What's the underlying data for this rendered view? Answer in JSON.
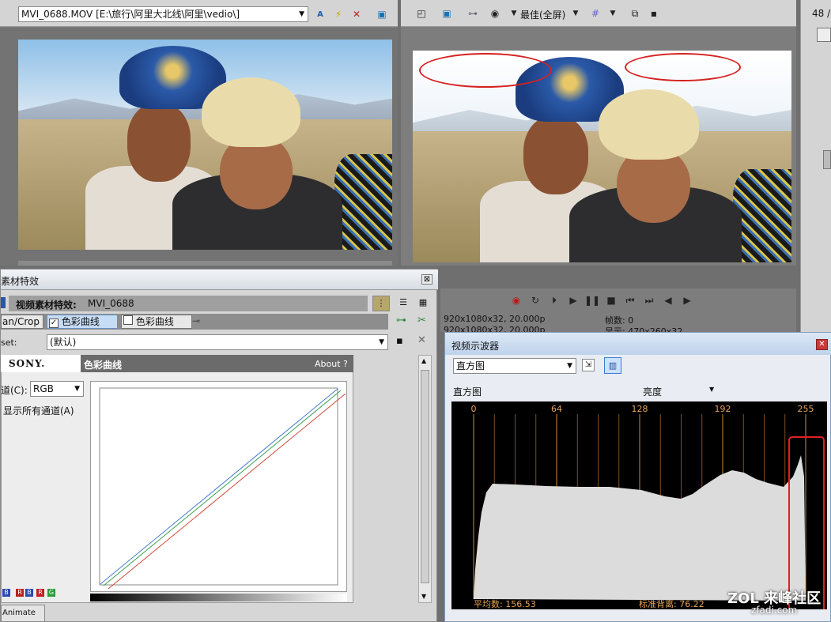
{
  "trimmer": {
    "file_select": "MVI_0688.MOV     [E:\\旅行\\阿里大北线\\阿里\\vedio\\]"
  },
  "preview": {
    "quality": "最佳(全屏)",
    "info_left": [
      "920x1080x32, 20.000p",
      "920x1080x32, 20.000p"
    ],
    "info_right": [
      "帧数: 0",
      "显示: 470x260x32"
    ]
  },
  "right_panel": {
    "label": "48 /"
  },
  "fx": {
    "window_title": "素材特效",
    "header_label": "视频素材特效:",
    "header_clip": "MVI_0688",
    "chain": [
      "an/Crop",
      "色彩曲线",
      "色彩曲线"
    ],
    "preset_label": "set:",
    "preset_value": "(默认)",
    "brand": "SONY.",
    "plugin_title": "色彩曲线",
    "about": "About  ?",
    "channel_label": "道(C):",
    "channel_value": "RGB",
    "show_all": "显示所有通道(A)",
    "rgb_buttons": [
      "B",
      "R",
      "B",
      "R",
      "G"
    ],
    "animate": "Animate"
  },
  "scope": {
    "title": "视频示波器",
    "mode": "直方图",
    "hist_label": "直方图",
    "brightness": "亮度",
    "ticks": [
      "0",
      "64",
      "128",
      "192",
      "255"
    ],
    "mean": "平均数: 156.53",
    "stddev": "标准背离: 76.22"
  },
  "watermark": {
    "text": "ZOL 来峰社区",
    "sub": "zfadi.com"
  }
}
